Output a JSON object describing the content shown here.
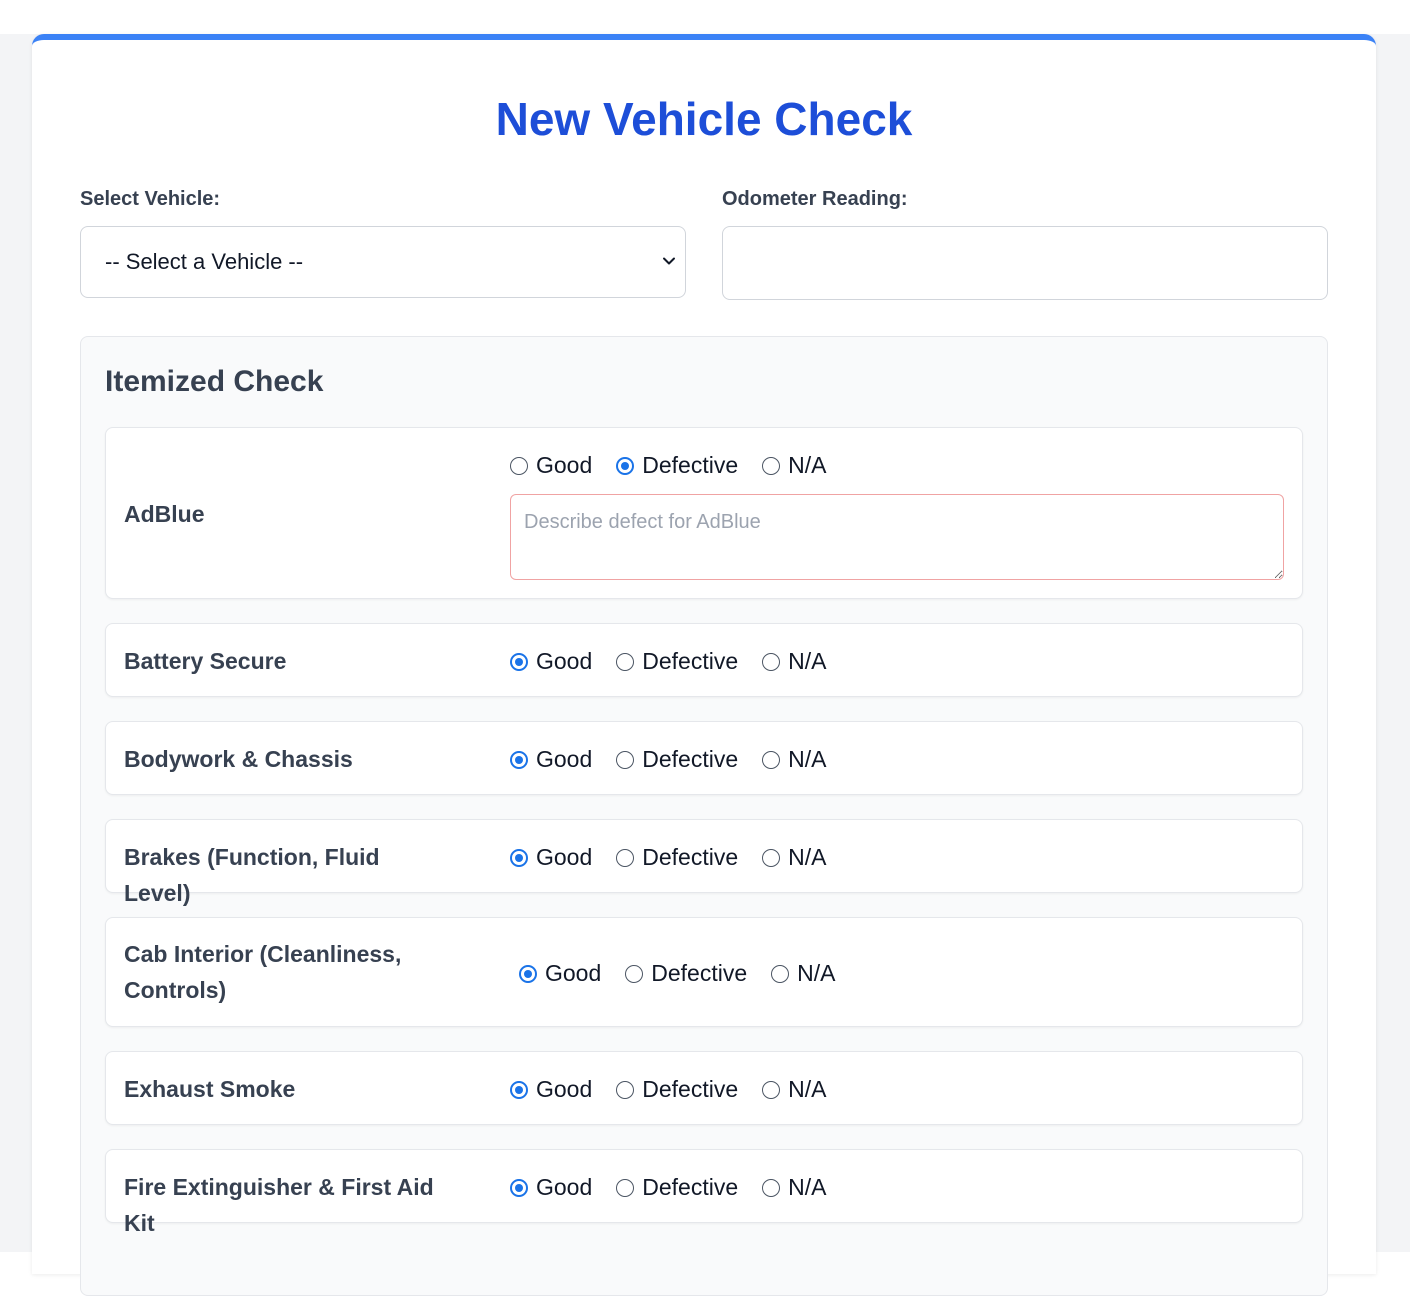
{
  "title": "New Vehicle Check",
  "vehicle_field": {
    "label": "Select Vehicle:",
    "selected": "-- Select a Vehicle --",
    "chevron_icon": "chevron-down-icon"
  },
  "odometer_field": {
    "label": "Odometer Reading:",
    "value": "",
    "placeholder": ""
  },
  "itemized": {
    "title": "Itemized Check",
    "option_labels": [
      "Good",
      "Defective",
      "N/A"
    ],
    "items": [
      {
        "label": "AdBlue",
        "selected": "Defective",
        "defect_placeholder": "Describe defect for AdBlue"
      },
      {
        "label": "Battery Secure",
        "selected": "Good"
      },
      {
        "label": "Bodywork & Chassis",
        "selected": "Good"
      },
      {
        "label": "Brakes (Function, Fluid Level)",
        "selected": "Good"
      },
      {
        "label": "Cab Interior (Cleanliness, Controls)",
        "selected": "Good"
      },
      {
        "label": "Exhaust Smoke",
        "selected": "Good"
      },
      {
        "label": "Fire Extinguisher & First Aid Kit",
        "selected": "Good"
      }
    ]
  },
  "colors": {
    "accent": "#1d4ed8",
    "top_border": "#3b82f6",
    "radio_checked": "#1a73e8",
    "defect_border": "#f0a3a3"
  }
}
